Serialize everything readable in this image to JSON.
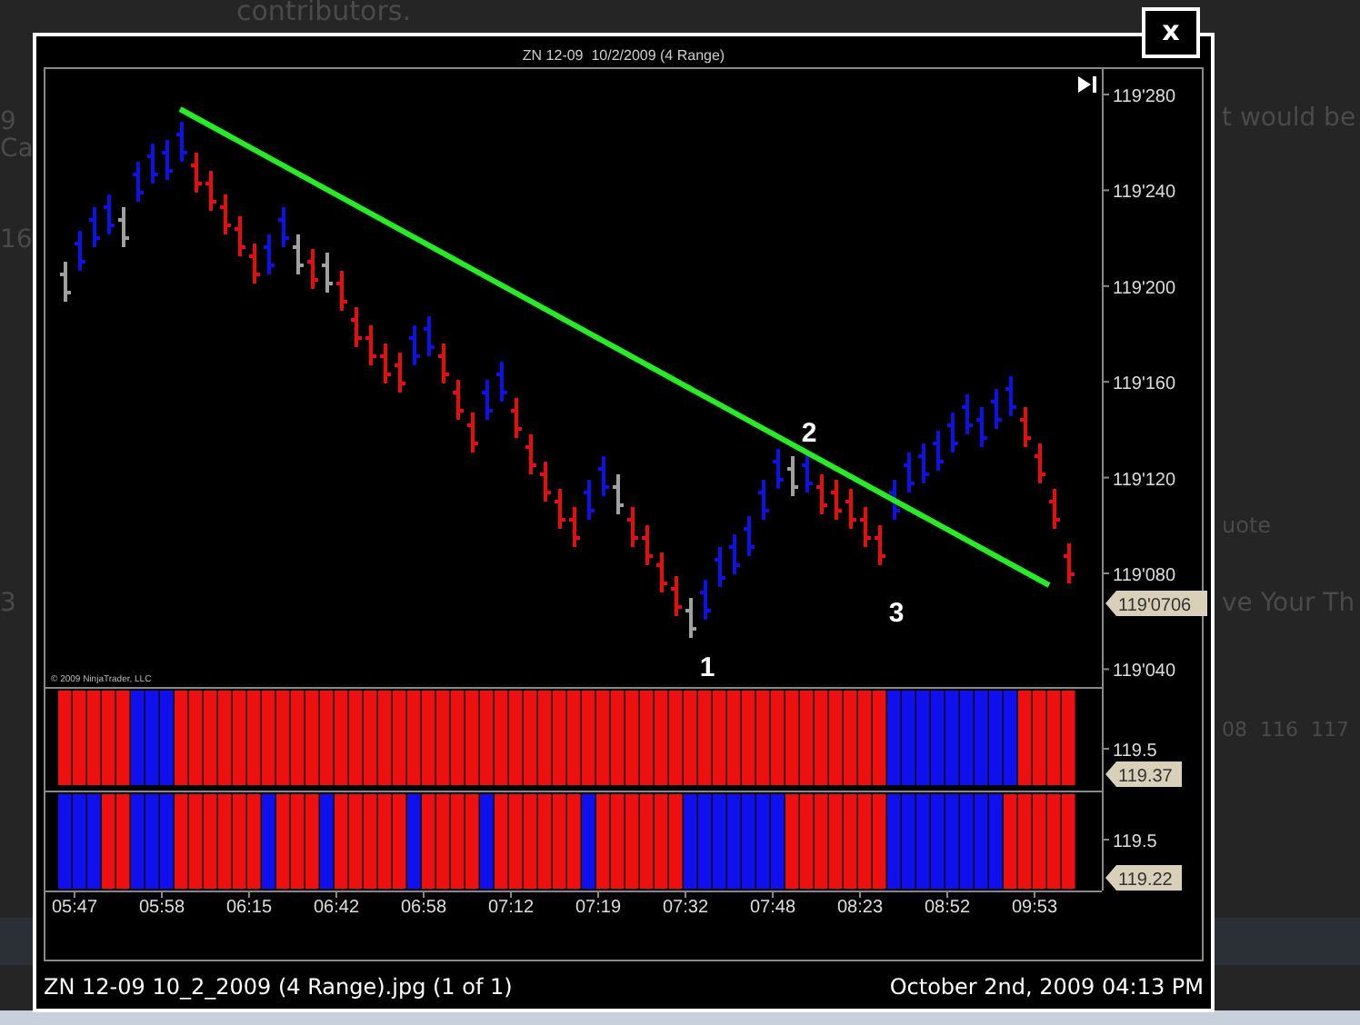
{
  "background_page": {
    "texts": [
      "contributors.",
      "9",
      "Ca",
      "16",
      "3",
      "t would be",
      "uote",
      "ve Your Th",
      "08  116  117"
    ]
  },
  "lightbox": {
    "close_button": "x",
    "image": {
      "title": "ZN 12-09  10/2/2009 (4 Range)",
      "price_axis": {
        "labels": [
          "119'280",
          "119'240",
          "119'200",
          "119'160",
          "119'120",
          "119'080",
          "119'040"
        ],
        "current_price": "119'0706"
      },
      "copyright": "© 2009 NinjaTrader, LLC",
      "annotations": [
        "1",
        "2",
        "3"
      ],
      "indicator_1": {
        "axis_label": "119.5",
        "current_value": "119.37"
      },
      "indicator_2": {
        "axis_label": "119.5",
        "current_value": "119.22"
      },
      "time_axis": [
        "05:47",
        "05:58",
        "06:15",
        "06:42",
        "06:58",
        "07:12",
        "07:19",
        "07:32",
        "07:48",
        "08:23",
        "08:52",
        "09:53"
      ]
    },
    "caption": {
      "file_name": "ZN 12-09 10_2_2009 (4 Range).jpg (1 of 1)",
      "date": "October 2nd, 2009 04:13 PM"
    }
  }
}
